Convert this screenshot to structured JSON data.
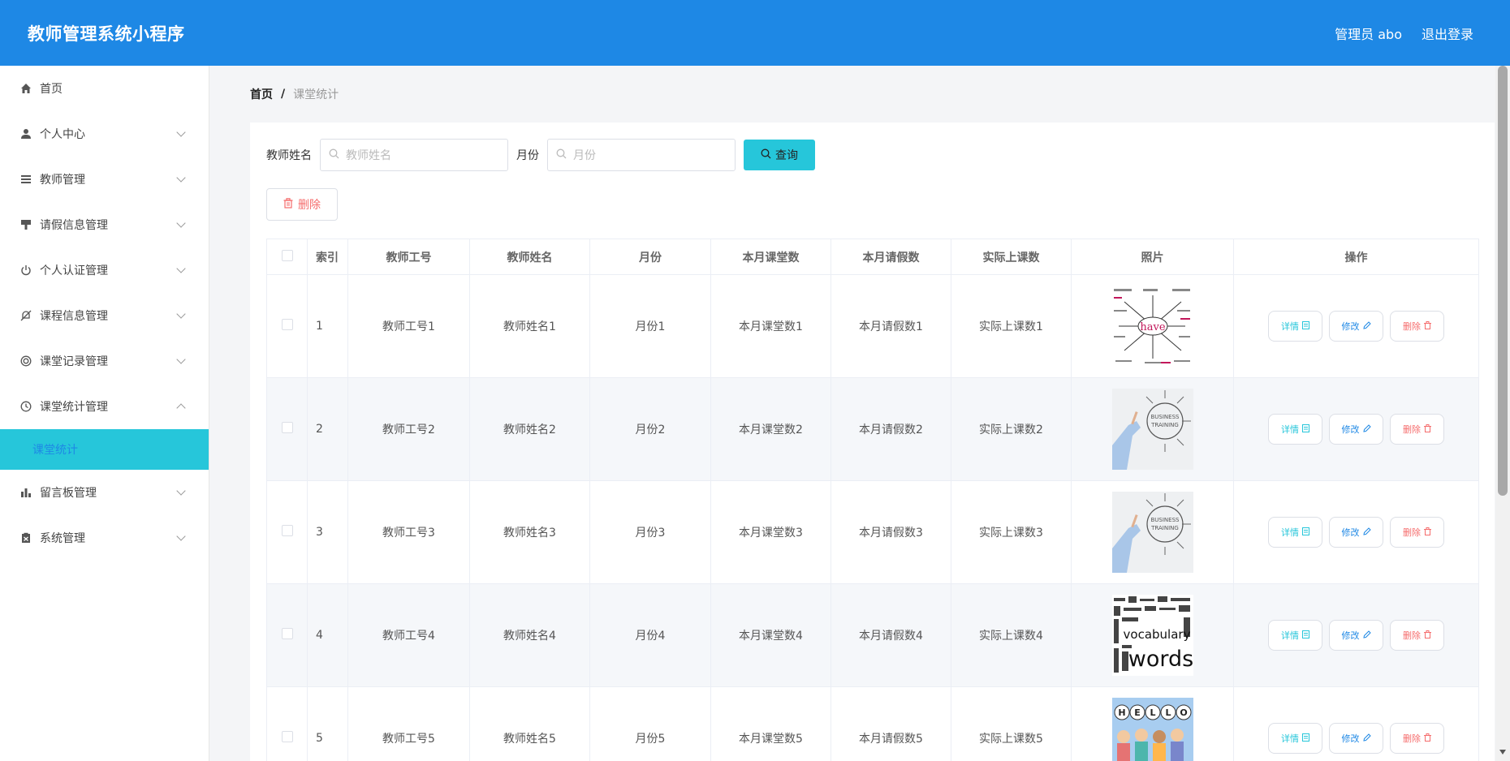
{
  "header": {
    "title": "教师管理系统小程序",
    "user": "管理员 abo",
    "logout": "退出登录"
  },
  "sidebar": {
    "items": [
      {
        "label": "首页",
        "icon": "home-icon"
      },
      {
        "label": "个人中心",
        "icon": "user-icon"
      },
      {
        "label": "教师管理",
        "icon": "list-icon"
      },
      {
        "label": "请假信息管理",
        "icon": "brush-icon"
      },
      {
        "label": "个人认证管理",
        "icon": "power-icon"
      },
      {
        "label": "课程信息管理",
        "icon": "bell-off-icon"
      },
      {
        "label": "课堂记录管理",
        "icon": "lifebuoy-icon"
      },
      {
        "label": "课堂统计管理",
        "icon": "clock-icon"
      },
      {
        "label": "留言板管理",
        "icon": "bar-chart-icon"
      },
      {
        "label": "系统管理",
        "icon": "clipboard-icon"
      }
    ],
    "active_sub": "课堂统计"
  },
  "breadcrumb": {
    "home": "首页",
    "sep": "/",
    "current": "课堂统计"
  },
  "search": {
    "name_label": "教师姓名",
    "name_placeholder": "教师姓名",
    "month_label": "月份",
    "month_placeholder": "月份",
    "query_label": "查询"
  },
  "actions": {
    "delete_label": "删除"
  },
  "table": {
    "headers": [
      "索引",
      "教师工号",
      "教师姓名",
      "月份",
      "本月课堂数",
      "本月请假数",
      "实际上课数",
      "照片",
      "操作"
    ],
    "rows": [
      {
        "idx": "1",
        "no": "教师工号1",
        "name": "教师姓名1",
        "month": "月份1",
        "classes": "本月课堂数1",
        "leaves": "本月请假数1",
        "actual": "实际上课数1",
        "photo": "have-mindmap"
      },
      {
        "idx": "2",
        "no": "教师工号2",
        "name": "教师姓名2",
        "month": "月份2",
        "classes": "本月课堂数2",
        "leaves": "本月请假数2",
        "actual": "实际上课数2",
        "photo": "business-training"
      },
      {
        "idx": "3",
        "no": "教师工号3",
        "name": "教师姓名3",
        "month": "月份3",
        "classes": "本月课堂数3",
        "leaves": "本月请假数3",
        "actual": "实际上课数3",
        "photo": "business-training"
      },
      {
        "idx": "4",
        "no": "教师工号4",
        "name": "教师姓名4",
        "month": "月份4",
        "classes": "本月课堂数4",
        "leaves": "本月请假数4",
        "actual": "实际上课数4",
        "photo": "vocabulary-words"
      },
      {
        "idx": "5",
        "no": "教师工号5",
        "name": "教师姓名5",
        "month": "月份5",
        "classes": "本月课堂数5",
        "leaves": "本月请假数5",
        "actual": "实际上课数5",
        "photo": "hello-kids"
      }
    ],
    "op_detail": "详情",
    "op_edit": "修改",
    "op_delete": "删除"
  },
  "photo_text": {
    "have": "have",
    "business": "BUSINESS",
    "training": "TRAINING",
    "vocabulary": "vocabulary",
    "words": "words",
    "hello": [
      "H",
      "E",
      "L",
      "L",
      "O"
    ]
  },
  "colors": {
    "header": "#1e88e5",
    "accent": "#26c6da",
    "danger": "#f56c6c"
  }
}
